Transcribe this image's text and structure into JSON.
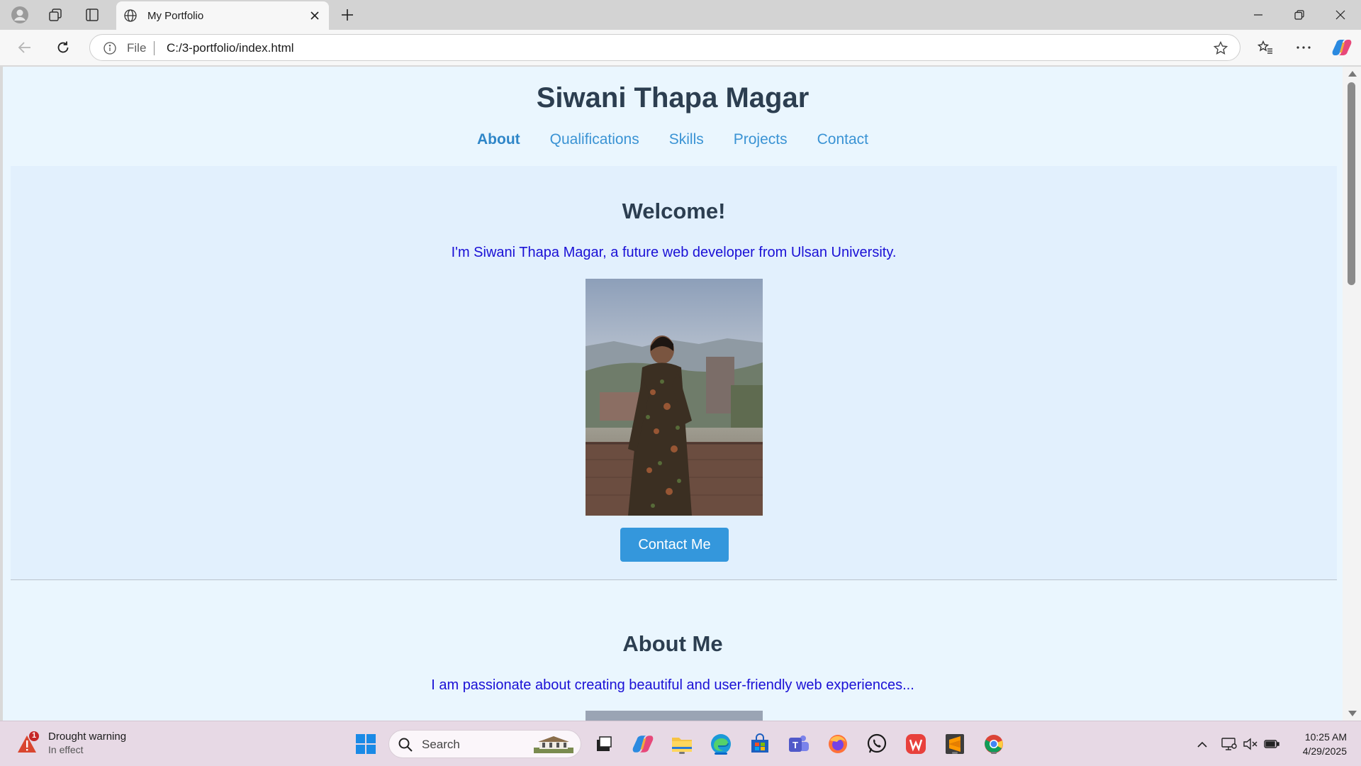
{
  "browser": {
    "tab_title": "My Portfolio",
    "address_scheme": "File",
    "address_url": "C:/3-portfolio/index.html"
  },
  "page": {
    "site_title": "Siwani Thapa Magar",
    "nav": [
      "About",
      "Qualifications",
      "Skills",
      "Projects",
      "Contact"
    ],
    "active_nav": "About",
    "hero": {
      "heading": "Welcome!",
      "intro": "I'm Siwani Thapa Magar, a future web developer from Ulsan University.",
      "cta_label": "Contact Me"
    },
    "about": {
      "heading": "About Me",
      "text": "I am passionate about creating beautiful and user-friendly web experiences..."
    }
  },
  "taskbar": {
    "weather_title": "Drought warning",
    "weather_sub": "In effect",
    "weather_badge": "1",
    "search_placeholder": "Search",
    "time": "10:25 AM",
    "date": "4/29/2025"
  },
  "colors": {
    "accent": "#3497dc",
    "heading": "#2c3e50",
    "intro_text": "#1a10d6",
    "page_bg": "#eaf6fe"
  }
}
